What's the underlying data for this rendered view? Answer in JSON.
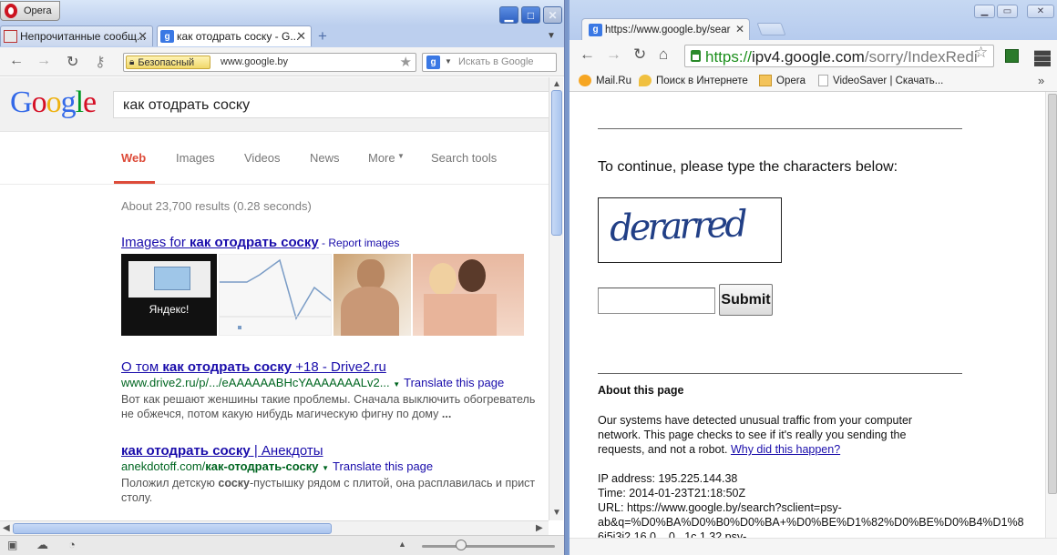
{
  "opera": {
    "menu_label": "Opera",
    "tabs": [
      {
        "label": "Непрочитанные сообщ...",
        "active": false
      },
      {
        "label": "как отодрать соску - G...",
        "active": true
      }
    ],
    "address": {
      "security_label": "Безопасный",
      "url": "www.google.by"
    },
    "search_placeholder": "Искать в Google"
  },
  "google": {
    "logo": {
      "G": "G",
      "o1": "o",
      "o2": "o",
      "g": "g",
      "l": "l",
      "e": "e"
    },
    "query": "как отодрать соску",
    "nav": [
      "Web",
      "Images",
      "Videos",
      "News",
      "More",
      "Search tools"
    ],
    "stats": "About 23,700 results (0.28 seconds)",
    "images_block": {
      "prefix": "Images for ",
      "query": "как отодрать соску",
      "report": " - Report images"
    },
    "thumb1_caption": "Яндекс!",
    "results": [
      {
        "title_prefix": "О том ",
        "title_bold": "как отодрать соску",
        "title_suffix": " +18 - Drive2.ru",
        "url": "www.drive2.ru/p/.../eAAAAAABHcYAAAAAAALv2...",
        "translate": "Translate this page",
        "snippet1": "Вот как решают женшины такие проблемы. Сначала выключить обогреватель",
        "snippet2_plain": "не обжечся, потом какую нибудь магическую фигну по дому ",
        "snippet2_bold": "..."
      },
      {
        "title_prefix": "",
        "title_bold": "как отодрать соску",
        "title_suffix": " | Анекдоты",
        "url_plain": "anekdotoff.com/",
        "url_bold": "как-отодрать-соску",
        "translate": "Translate this page",
        "snippet1_a": "Положил детскую ",
        "snippet1_b": "соску",
        "snippet1_c": "-пустышку рядом с плитой, она расплавилась и прист",
        "snippet2": "столу."
      }
    ]
  },
  "chrome": {
    "tab_label": "https://www.google.by/sear",
    "url": {
      "scheme": "https://",
      "host": "ipv4.google.com",
      "path": "/sorry/IndexRedi"
    },
    "bookmarks": [
      "Mail.Ru",
      "Поиск в Интернете",
      "Opera",
      "VideoSaver | Скачать..."
    ],
    "more": "»"
  },
  "sorry_page": {
    "heading": "To continue, please type the characters below:",
    "captcha_text": "derarred",
    "submit": "Submit",
    "about_title": "About this page",
    "about_lines": [
      "Our systems have detected unusual traffic from your computer",
      "network. This page checks to see if it's really you sending the"
    ],
    "about_line3_plain": "requests, and not a robot. ",
    "why_link": "Why did this happen?",
    "ip": "IP address: 195.225.144.38",
    "time": "Time: 2014-01-23T21:18:50Z",
    "url_line1": "URL: https://www.google.by/search?sclient=psy-",
    "url_line2": "ab&q=%D0%BA%D0%B0%D0%BA+%D0%BE%D1%82%D0%BE%D0%B4%D1%8",
    "url_line3": "6i5i3i2.16.0....0...1c.1.32.psy-"
  },
  "colors": {
    "google_red": "#dd4b39",
    "link_blue": "#1a0dab",
    "url_green": "#006621",
    "chrome_https_green": "#1c8f1c"
  }
}
